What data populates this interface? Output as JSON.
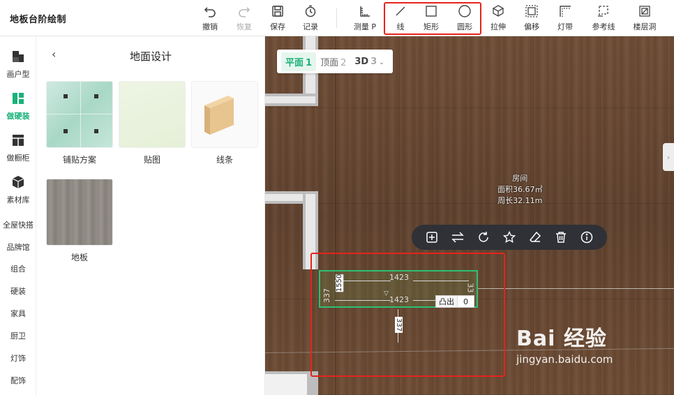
{
  "app_title": "地板台阶绘制",
  "toolbar": {
    "undo": "撤销",
    "redo": "恢复",
    "save": "保存",
    "history": "记录",
    "measure": "测量 P",
    "line": "线",
    "rect": "矩形",
    "circle": "圆形",
    "extrude": "拉伸",
    "offset": "偏移",
    "light_strip": "灯带",
    "reference_line": "参考线",
    "floor_hole": "楼层洞"
  },
  "leftnav": {
    "floorplan": "画户型",
    "hardfit": "做硬装",
    "cabinet": "做橱柜",
    "materials": "素材库",
    "links": [
      "全屋快搭",
      "品牌馆",
      "组合",
      "硬装",
      "家具",
      "厨卫",
      "灯饰",
      "配饰"
    ]
  },
  "panel": {
    "title": "地面设计",
    "tiles": [
      "铺贴方案",
      "贴图",
      "线条",
      "地板"
    ]
  },
  "canvas": {
    "view_switch": [
      {
        "label": "平面",
        "num": "1"
      },
      {
        "label": "顶面",
        "num": "2"
      },
      {
        "label": "3D",
        "num": "3"
      }
    ],
    "room_name": "房间",
    "room_area": "面积36.67㎡",
    "room_perimeter": "周长32.11m",
    "dim_top": "1423",
    "dim_bottom": "1423",
    "dim_left": "337",
    "dim_left_inner": "1550",
    "dim_right": "33",
    "dim_below": "337",
    "protrude_label": "凸出",
    "protrude_value": "0"
  },
  "watermark": {
    "brand": "Bai 经验",
    "url": "jingyan.baidu.com"
  },
  "colors": {
    "accent": "#1ab27a",
    "highlight": "#e5231d",
    "ctx_bar": "#2f3136",
    "selection": "#2fbf74"
  }
}
